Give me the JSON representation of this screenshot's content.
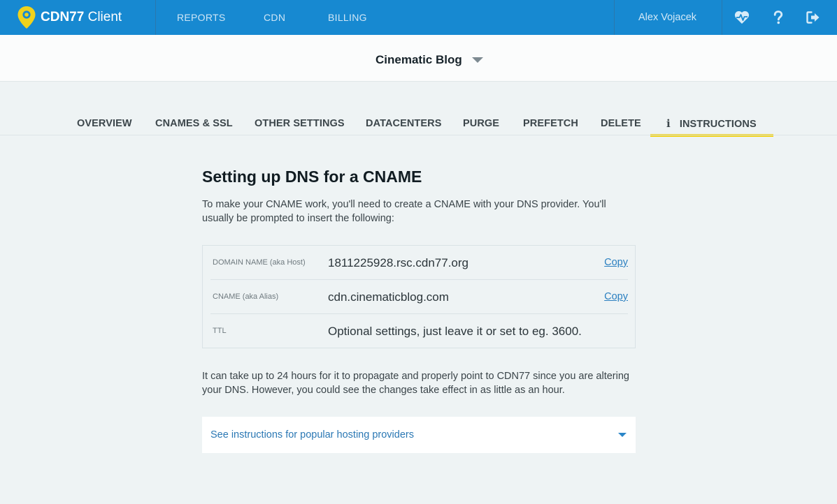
{
  "app": {
    "brand_bold": "CDN77",
    "brand_light": "Client",
    "nav": [
      {
        "label": "REPORTS"
      },
      {
        "label": "CDN"
      },
      {
        "label": "BILLING"
      }
    ],
    "user_name": "Alex Vojacek",
    "icons": [
      "heartbeat-icon",
      "help-icon",
      "logout-icon"
    ],
    "colors": {
      "header_bg": "#1789d1",
      "accent_tab": "#f0d21c",
      "link": "#2a7fc0",
      "logo_pin": "#f0d21c"
    }
  },
  "site": {
    "name": "Cinematic Blog"
  },
  "tabs": [
    {
      "label": "OVERVIEW"
    },
    {
      "label": "CNAMES & SSL"
    },
    {
      "label": "OTHER SETTINGS"
    },
    {
      "label": "DATACENTERS"
    },
    {
      "label": "PURGE"
    },
    {
      "label": "PREFETCH"
    },
    {
      "label": "DELETE"
    },
    {
      "label": "INSTRUCTIONS",
      "icon": "info-icon",
      "active": true
    }
  ],
  "main": {
    "title": "Setting up DNS for a CNAME",
    "intro": "To make your CNAME work, you'll need to create a CNAME with your DNS provider. You'll usually be prompted to insert the following:",
    "rows": [
      {
        "label": "DOMAIN NAME (aka Host)",
        "value": "1811225928.rsc.cdn77.org",
        "action": "Copy"
      },
      {
        "label": "CNAME (aka Alias)",
        "value": "cdn.cinematicblog.com",
        "action": "Copy"
      },
      {
        "label": "TTL",
        "value": "Optional settings, just leave it or set to eg. 3600."
      }
    ],
    "note": "It can take up to 24 hours for it to propagate and properly point to CDN77 since you are altering your DNS. However, you could see the changes take effect in as little as an hour.",
    "accordion_label": "See instructions for popular hosting providers"
  }
}
